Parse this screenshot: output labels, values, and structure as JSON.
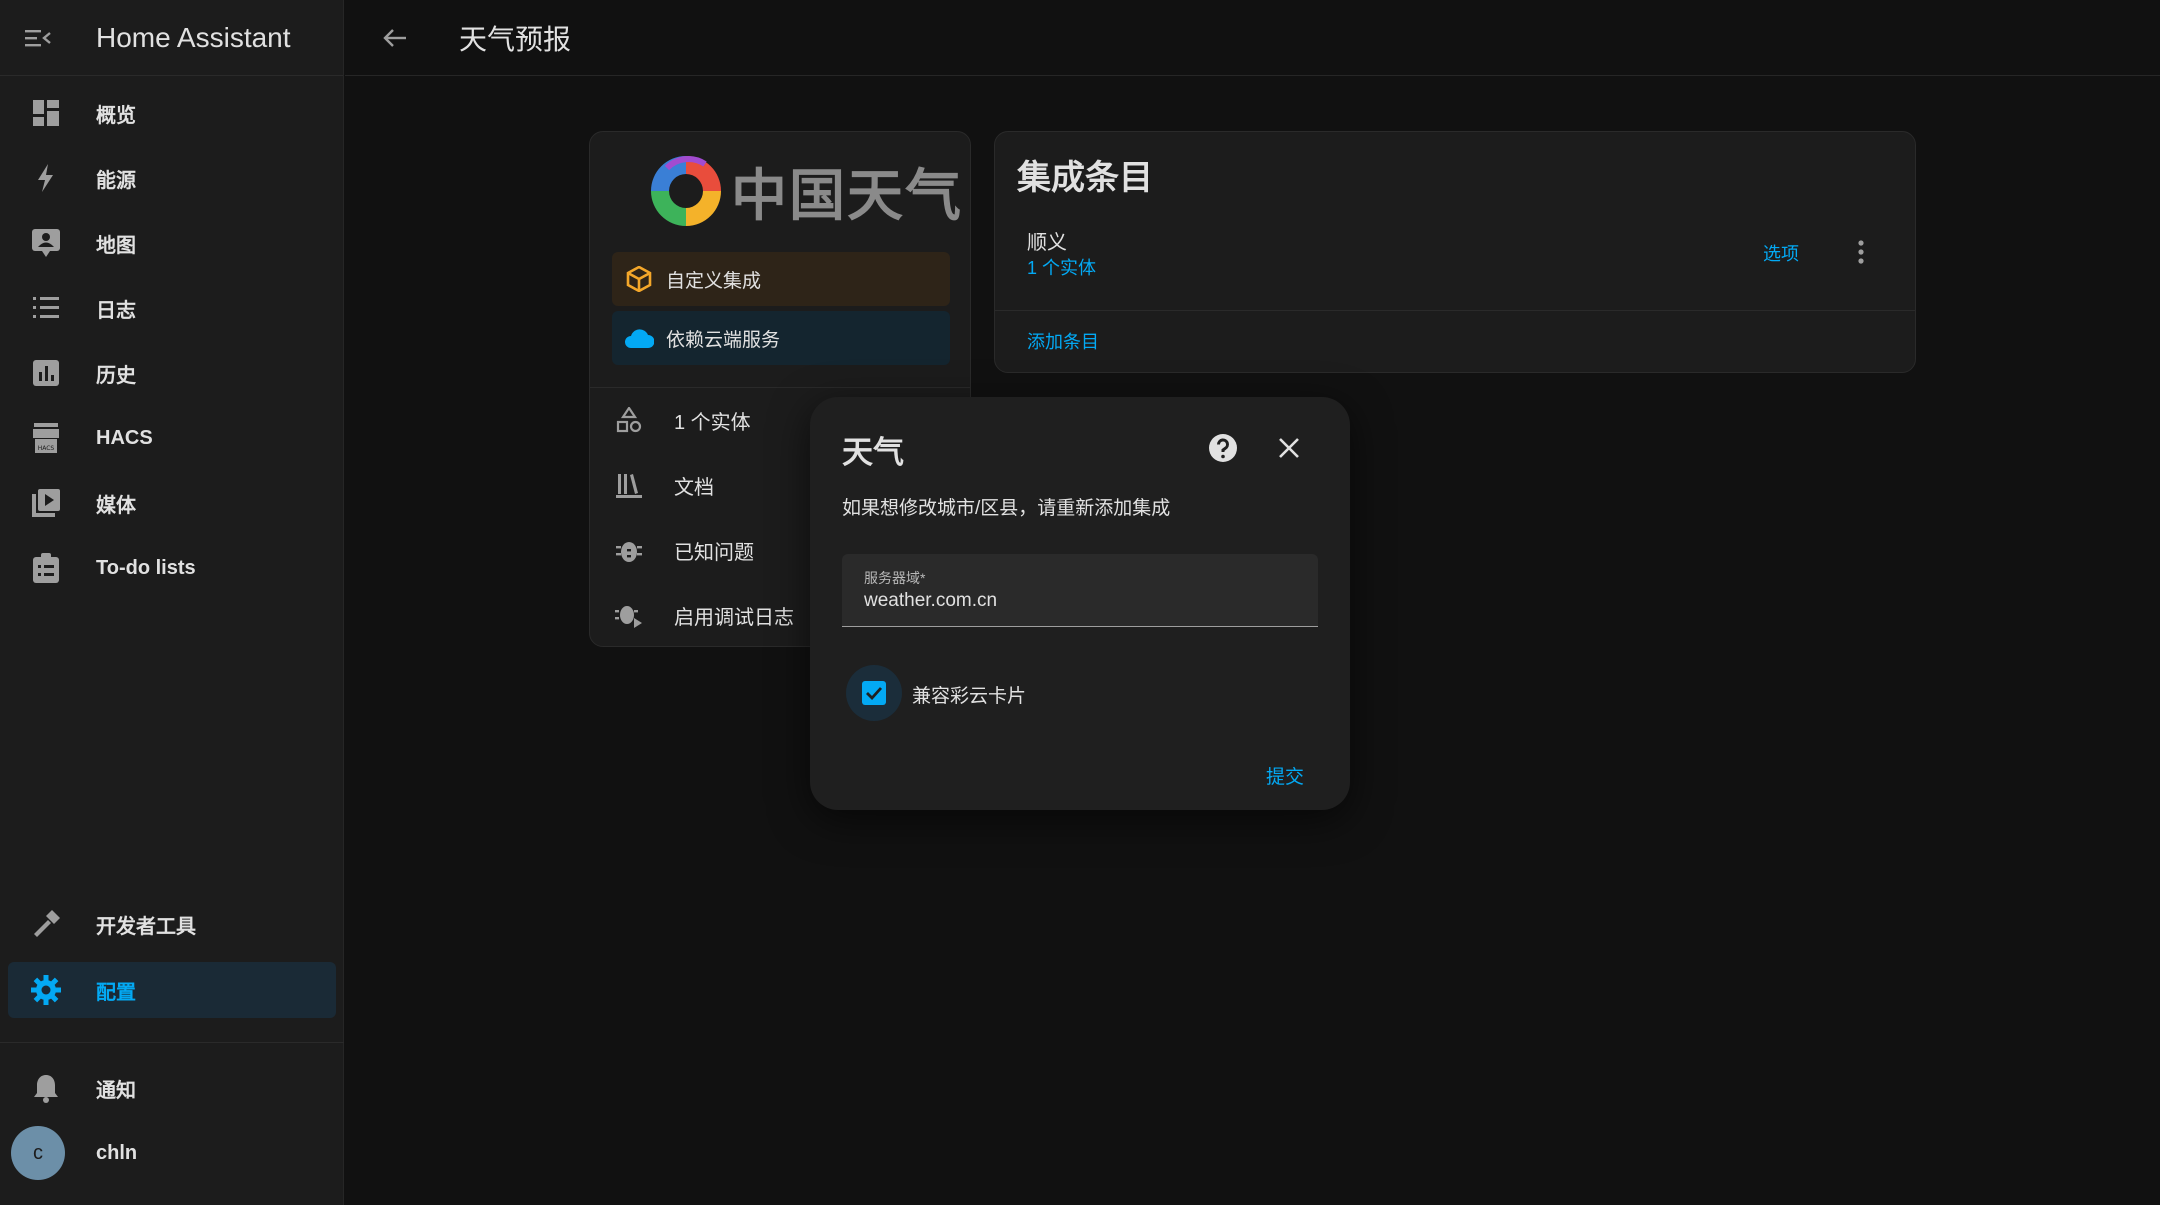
{
  "app": {
    "title": "Home Assistant"
  },
  "sidebar": {
    "items": [
      {
        "label": "概览",
        "icon": "dashboard-icon"
      },
      {
        "label": "能源",
        "icon": "lightning-icon"
      },
      {
        "label": "地图",
        "icon": "map-account-icon"
      },
      {
        "label": "日志",
        "icon": "list-icon"
      },
      {
        "label": "历史",
        "icon": "chart-box-icon"
      },
      {
        "label": "HACS",
        "icon": "hacs-store-icon"
      },
      {
        "label": "媒体",
        "icon": "play-box-icon"
      },
      {
        "label": "To-do lists",
        "icon": "clipboard-list-icon"
      }
    ],
    "bottom_items": [
      {
        "label": "开发者工具",
        "icon": "hammer-icon"
      },
      {
        "label": "配置",
        "icon": "gear-icon",
        "active": true
      }
    ],
    "notifications_label": "通知",
    "user": {
      "initial": "c",
      "name": "chln"
    }
  },
  "topbar": {
    "title": "天气预报"
  },
  "integration_info": {
    "logo_text": "中国天气",
    "chips": [
      {
        "label": "自定义集成",
        "icon": "package-icon"
      },
      {
        "label": "依赖云端服务",
        "icon": "cloud-icon"
      }
    ],
    "rows": [
      {
        "label": "1 个实体",
        "icon": "shapes-icon"
      },
      {
        "label": "文档",
        "icon": "library-icon"
      },
      {
        "label": "已知问题",
        "icon": "bug-icon"
      },
      {
        "label": "启用调试日志",
        "icon": "bug-play-icon"
      }
    ]
  },
  "entries": {
    "title": "集成条目",
    "items": [
      {
        "name": "顺义",
        "subtitle": "1 个实体",
        "options_label": "选项"
      }
    ],
    "add_label": "添加条目"
  },
  "dialog": {
    "title": "天气",
    "description": "如果想修改城市/区县，请重新添加集成",
    "field": {
      "label": "服务器域*",
      "value": "weather.com.cn"
    },
    "checkbox": {
      "label": "兼容彩云卡片",
      "checked": true
    },
    "submit_label": "提交"
  },
  "colors": {
    "accent": "#03a9f4",
    "background": "#111111",
    "card": "#1c1c1c",
    "custom_chip": "#f4a72a"
  }
}
